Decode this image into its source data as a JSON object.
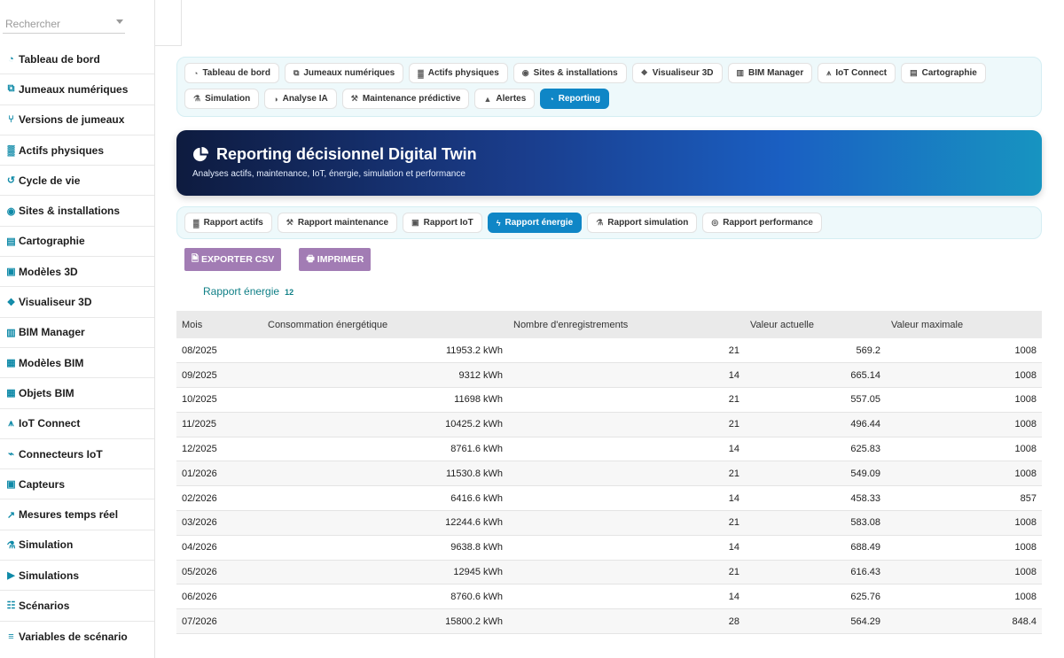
{
  "sidebar": {
    "search_placeholder": "Rechercher",
    "items": [
      {
        "label": "Tableau de bord",
        "icon": "dashboard-icon"
      },
      {
        "label": "Jumeaux numériques",
        "icon": "clone-icon"
      },
      {
        "label": "Versions de jumeaux",
        "icon": "branch-icon"
      },
      {
        "label": "Actifs physiques",
        "icon": "industry-icon"
      },
      {
        "label": "Cycle de vie",
        "icon": "history-icon"
      },
      {
        "label": "Sites & installations",
        "icon": "map-pin-icon"
      },
      {
        "label": "Cartographie",
        "icon": "map-icon"
      },
      {
        "label": "Modèles 3D",
        "icon": "cube-icon"
      },
      {
        "label": "Visualiseur 3D",
        "icon": "cubes-icon"
      },
      {
        "label": "BIM Manager",
        "icon": "building-icon"
      },
      {
        "label": "Modèles BIM",
        "icon": "city-icon"
      },
      {
        "label": "Objets BIM",
        "icon": "grid-icon"
      },
      {
        "label": "IoT Connect",
        "icon": "antenna-icon"
      },
      {
        "label": "Connecteurs IoT",
        "icon": "plug-icon"
      },
      {
        "label": "Capteurs",
        "icon": "chip-icon"
      },
      {
        "label": "Mesures temps réel",
        "icon": "line-chart-icon"
      },
      {
        "label": "Simulation",
        "icon": "flask-icon"
      },
      {
        "label": "Simulations",
        "icon": "play-circle-icon"
      },
      {
        "label": "Scénarios",
        "icon": "project-diagram-icon"
      },
      {
        "label": "Variables de scénario",
        "icon": "sliders-icon"
      }
    ]
  },
  "nav": {
    "items": [
      {
        "label": "Tableau de bord",
        "icon": "dashboard-icon",
        "active": false
      },
      {
        "label": "Jumeaux numériques",
        "icon": "clone-icon",
        "active": false
      },
      {
        "label": "Actifs physiques",
        "icon": "industry-icon",
        "active": false
      },
      {
        "label": "Sites & installations",
        "icon": "map-pin-icon",
        "active": false
      },
      {
        "label": "Visualiseur 3D",
        "icon": "cubes-icon",
        "active": false
      },
      {
        "label": "BIM Manager",
        "icon": "building-icon",
        "active": false
      },
      {
        "label": "IoT Connect",
        "icon": "antenna-icon",
        "active": false
      },
      {
        "label": "Cartographie",
        "icon": "map-icon",
        "active": false
      },
      {
        "label": "Simulation",
        "icon": "flask-icon",
        "active": false
      },
      {
        "label": "Analyse IA",
        "icon": "brain-icon",
        "active": false
      },
      {
        "label": "Maintenance prédictive",
        "icon": "tools-icon",
        "active": false
      },
      {
        "label": "Alertes",
        "icon": "bell-icon",
        "active": false
      },
      {
        "label": "Reporting",
        "icon": "pie-chart-icon",
        "active": true
      }
    ]
  },
  "hero": {
    "title": "Reporting décisionnel Digital Twin",
    "subtitle": "Analyses actifs, maintenance, IoT, énergie, simulation et performance"
  },
  "report_tabs": [
    {
      "label": "Rapport actifs",
      "icon": "industry-icon",
      "active": false
    },
    {
      "label": "Rapport maintenance",
      "icon": "tools-icon",
      "active": false
    },
    {
      "label": "Rapport IoT",
      "icon": "chip-icon",
      "active": false
    },
    {
      "label": "Rapport énergie",
      "icon": "bolt-icon",
      "active": true
    },
    {
      "label": "Rapport simulation",
      "icon": "flask-icon",
      "active": false
    },
    {
      "label": "Rapport performance",
      "icon": "target-icon",
      "active": false
    }
  ],
  "actions": {
    "export_label": "EXPORTER CSV",
    "print_label": "IMPRIMER"
  },
  "report": {
    "name": "Rapport énergie",
    "count": "12"
  },
  "table": {
    "headers": [
      "Mois",
      "Consommation énergétique",
      "Nombre d'enregistrements",
      "Valeur actuelle",
      "Valeur maximale"
    ],
    "rows": [
      [
        "08/2025",
        "11953.2 kWh",
        "21",
        "569.2",
        "1008"
      ],
      [
        "09/2025",
        "9312 kWh",
        "14",
        "665.14",
        "1008"
      ],
      [
        "10/2025",
        "11698 kWh",
        "21",
        "557.05",
        "1008"
      ],
      [
        "11/2025",
        "10425.2 kWh",
        "21",
        "496.44",
        "1008"
      ],
      [
        "12/2025",
        "8761.6 kWh",
        "14",
        "625.83",
        "1008"
      ],
      [
        "01/2026",
        "11530.8 kWh",
        "21",
        "549.09",
        "1008"
      ],
      [
        "02/2026",
        "6416.6 kWh",
        "14",
        "458.33",
        "857"
      ],
      [
        "03/2026",
        "12244.6 kWh",
        "21",
        "583.08",
        "1008"
      ],
      [
        "04/2026",
        "9638.8 kWh",
        "14",
        "688.49",
        "1008"
      ],
      [
        "05/2026",
        "12945 kWh",
        "21",
        "616.43",
        "1008"
      ],
      [
        "06/2026",
        "8760.6 kWh",
        "14",
        "625.76",
        "1008"
      ],
      [
        "07/2026",
        "15800.2 kWh",
        "28",
        "564.29",
        "848.4"
      ]
    ]
  },
  "colors": {
    "accent": "#0f86c6",
    "action_button": "#a27cb4",
    "teal_text": "#0f7f86",
    "sidebar_icon": "#0f8aa8"
  }
}
